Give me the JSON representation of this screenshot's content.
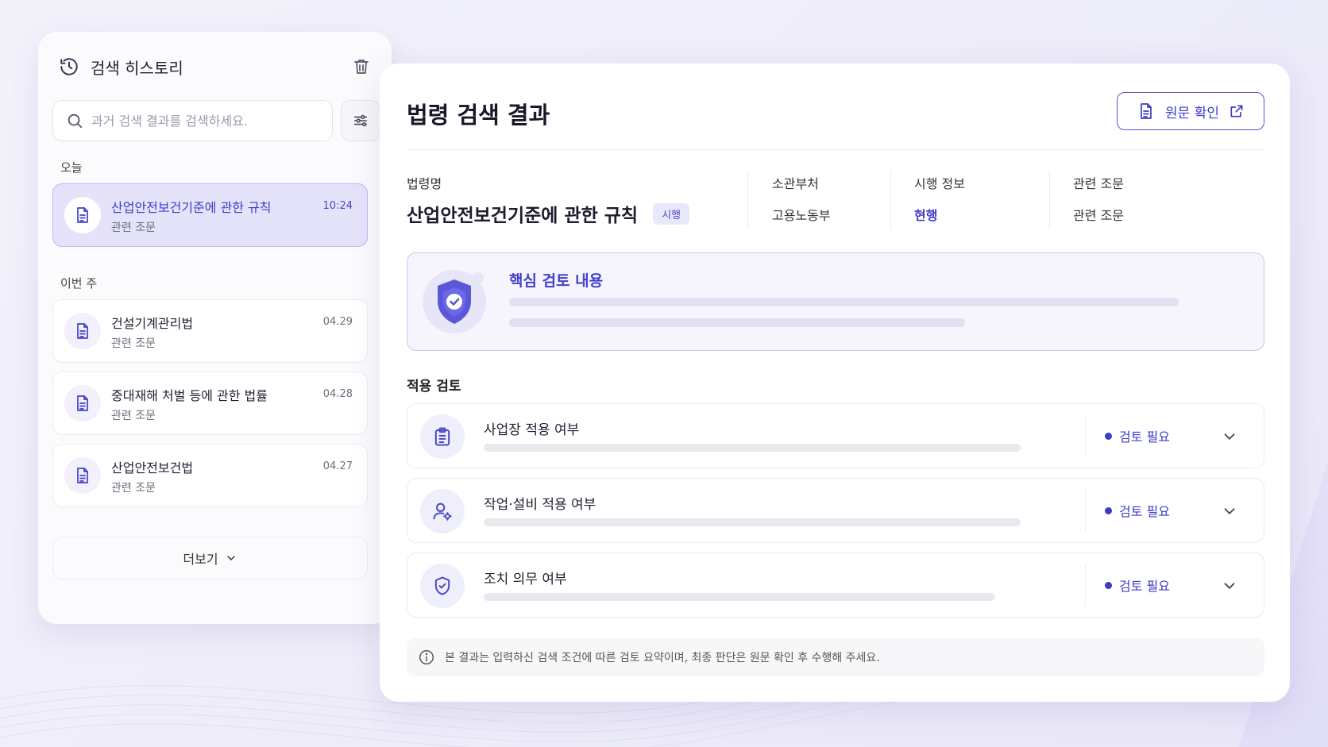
{
  "history": {
    "title": "검색 히스토리",
    "search_placeholder": "과거 검색 결과를 검색하세요.",
    "groups": [
      {
        "label": "오늘",
        "items": [
          {
            "title": "산업안전보건기준에 관한 규칙",
            "subtitle": "관련 조문",
            "time": "10:24",
            "active": true
          }
        ]
      },
      {
        "label": "이번 주",
        "items": [
          {
            "title": "건설기계관리법",
            "subtitle": "관련 조문",
            "time": "04.29"
          },
          {
            "title": "중대재해 처벌 등에 관한 법률",
            "subtitle": "관련 조문",
            "time": "04.28"
          },
          {
            "title": "산업안전보건법",
            "subtitle": "관련 조문",
            "time": "04.27"
          }
        ]
      }
    ],
    "more_label": "더보기"
  },
  "result": {
    "title": "법령 검색 결과",
    "origin_button": "원문 확인",
    "meta": {
      "law_label": "법령명",
      "law_name": "산업안전보건기준에 관한 규칙",
      "law_badge": "시행",
      "dept_label": "소관부처",
      "dept_value": "고용노동부",
      "status_label": "시행 정보",
      "status_value": "현행",
      "article_label": "관련 조문",
      "article_value": "관련 조문"
    },
    "key_review_title": "핵심 검토 내용",
    "section_label": "적용 검토",
    "reviews": [
      {
        "title": "사업장 적용 여부",
        "status": "검토 필요",
        "icon": "clipboard-icon"
      },
      {
        "title": "작업·설비 적용 여부",
        "status": "검토 필요",
        "icon": "user-gear-icon"
      },
      {
        "title": "조치 의무 여부",
        "status": "검토 필요",
        "icon": "shield-check-icon"
      }
    ],
    "notice": "본 결과는 입력하신 검색 조건에 따른 검토 요약이며, 최종 판단은 원문 확인 후 수행해 주세요."
  },
  "colors": {
    "accent": "#3e3bc9",
    "accent_light": "#e5e3fa",
    "background": "#f0eefa"
  }
}
